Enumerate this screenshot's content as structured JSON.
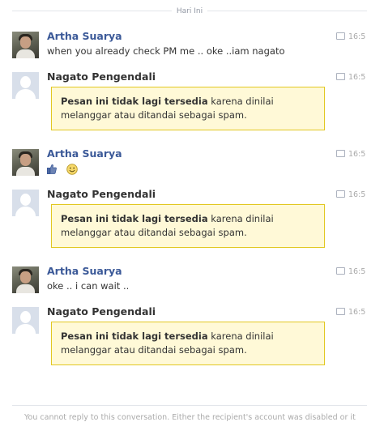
{
  "divider": {
    "label": "Hari Ini"
  },
  "messages": [
    {
      "name": "Artha Suarya",
      "time": "16:5",
      "text": "when you already check PM me .. oke ..iam nagato"
    },
    {
      "name": "Nagato Pengendali",
      "time": "16:5",
      "notice_bold": "Pesan ini tidak lagi tersedia",
      "notice_line1": " karena dinilai",
      "notice_line2": "melanggar atau ditandai sebagai spam."
    },
    {
      "name": "Artha Suarya",
      "time": "16:5"
    },
    {
      "name": "Nagato Pengendali",
      "time": "16:5",
      "notice_bold": "Pesan ini tidak lagi tersedia",
      "notice_line1": " karena dinilai",
      "notice_line2": "melanggar atau ditandai sebagai spam."
    },
    {
      "name": "Artha Suarya",
      "time": "16:5",
      "text": "oke .. i can wait .."
    },
    {
      "name": "Nagato Pengendali",
      "time": "16:5",
      "notice_bold": "Pesan ini tidak lagi tersedia",
      "notice_line1": " karena dinilai",
      "notice_line2": "melanggar atau ditandai sebagai spam."
    }
  ],
  "footer": {
    "text": "You cannot reply to this conversation. Either the recipient's account was disabled or it"
  },
  "colors": {
    "link": "#3b5998",
    "notice_bg": "#fff9d7",
    "notice_border": "#e2c822"
  }
}
